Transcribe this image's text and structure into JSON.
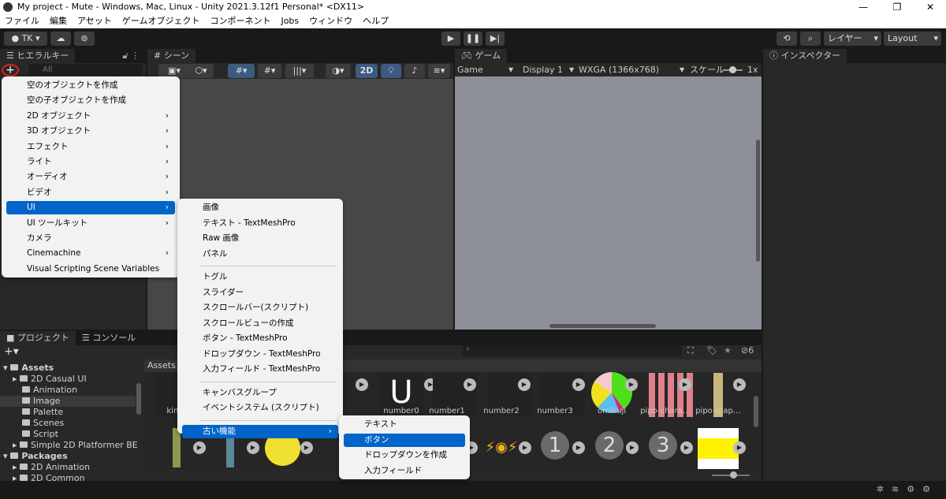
{
  "window": {
    "title": "My project - Mute - Windows, Mac, Linux - Unity 2021.3.12f1 Personal* <DX11>",
    "minimize": "—",
    "maximize": "❐",
    "close": "✕"
  },
  "menubar": [
    "ファイル",
    "編集",
    "アセット",
    "ゲームオブジェクト",
    "コンポーネント",
    "Jobs",
    "ウィンドウ",
    "ヘルプ"
  ],
  "toolbar": {
    "account": "TK ▾",
    "layers": "レイヤー",
    "layout": "Layout"
  },
  "hierarchy": {
    "tab": "ヒエラルキー",
    "search_placeholder": "All",
    "add": "+"
  },
  "scene": {
    "tab": "シーン",
    "mode_2d": "2D"
  },
  "game": {
    "tab": "ゲーム",
    "view": "Game",
    "display": "Display 1",
    "resolution": "WXGA (1366x768)",
    "scale_label": "スケール",
    "scale_value": "1x",
    "game_bg": "#8e9099"
  },
  "inspector": {
    "tab": "インスペクター"
  },
  "create_menu": {
    "items": [
      {
        "label": "空のオブジェクトを作成"
      },
      {
        "label": "空の子オブジェクトを作成"
      },
      {
        "label": "2D オブジェクト",
        "sub": true
      },
      {
        "label": "3D オブジェクト",
        "sub": true
      },
      {
        "label": "エフェクト",
        "sub": true
      },
      {
        "label": "ライト",
        "sub": true
      },
      {
        "label": "オーディオ",
        "sub": true
      },
      {
        "label": "ビデオ",
        "sub": true
      },
      {
        "label": "UI",
        "sub": true,
        "selected": true
      },
      {
        "label": "UI ツールキット",
        "sub": true
      },
      {
        "label": "カメラ"
      },
      {
        "label": "Cinemachine",
        "sub": true
      },
      {
        "label": "Visual Scripting Scene Variables"
      }
    ]
  },
  "ui_menu": {
    "group1": [
      "画像",
      "テキスト - TextMeshPro",
      "Raw 画像",
      "パネル"
    ],
    "group2": [
      "トグル",
      "スライダー",
      "スクロールバー(スクリプト)",
      "スクロールビューの作成",
      "ボタン - TextMeshPro",
      "ドロップダウン - TextMeshPro",
      "入力フィールド - TextMeshPro"
    ],
    "group3": [
      "キャンバスグループ",
      "イベントシステム (スクリプト)"
    ],
    "legacy": "古い機能"
  },
  "legacy_menu": {
    "items": [
      "テキスト",
      "ボタン",
      "ドロップダウンを作成",
      "入力フィールド"
    ],
    "selected": "ボタン"
  },
  "project": {
    "tab": "プロジェクト",
    "console_tab": "コンソール",
    "breadcrumb": "Assets",
    "hidden_count": "6",
    "tree": [
      {
        "label": "Assets",
        "level": 0,
        "bold": true
      },
      {
        "label": "2D Casual UI",
        "level": 1
      },
      {
        "label": "Animation",
        "level": 1
      },
      {
        "label": "Image",
        "level": 1,
        "selected": true
      },
      {
        "label": "Palette",
        "level": 1
      },
      {
        "label": "Scenes",
        "level": 1
      },
      {
        "label": "Script",
        "level": 1
      },
      {
        "label": "Simple 2D Platformer BE",
        "level": 1
      },
      {
        "label": "Packages",
        "level": 0,
        "bold": true
      },
      {
        "label": "2D Animation",
        "level": 1
      },
      {
        "label": "2D Common",
        "level": 1
      }
    ],
    "assets_row1": [
      "kinshi",
      "number0",
      "number1",
      "number2",
      "number3",
      "omikuji",
      "pipo-chara…",
      "pipo-map…"
    ],
    "number_icons": [
      "1",
      "2",
      "3"
    ]
  },
  "accent": "#0064c8"
}
